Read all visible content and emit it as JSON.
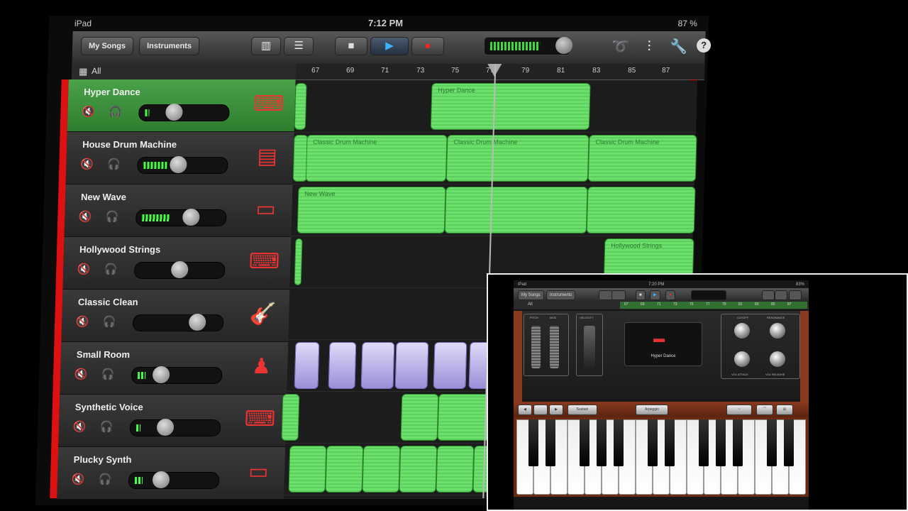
{
  "status": {
    "carrier": "iPad",
    "time": "7:12 PM",
    "battery": "87 %"
  },
  "toolbar": {
    "my_songs": "My Songs",
    "instruments": "Instruments"
  },
  "subbar": {
    "all": "All"
  },
  "ruler": {
    "bars": [
      "67",
      "69",
      "71",
      "73",
      "75",
      "77",
      "79",
      "81",
      "83",
      "85",
      "87"
    ]
  },
  "tracks": [
    {
      "name": "Hyper Dance",
      "level": 0.05,
      "volume": 0.36,
      "instrument_icon": "synth-keyboard-icon",
      "selected": true
    },
    {
      "name": "House Drum Machine",
      "level": 0.3,
      "volume": 0.44,
      "instrument_icon": "drum-machine-icon",
      "selected": false
    },
    {
      "name": "New Wave",
      "level": 0.35,
      "volume": 0.64,
      "instrument_icon": "synth-module-icon",
      "selected": false
    },
    {
      "name": "Hollywood Strings",
      "level": 0.0,
      "volume": 0.5,
      "instrument_icon": "synth-keyboard-icon",
      "selected": false
    },
    {
      "name": "Classic Clean",
      "level": 0.0,
      "volume": 0.76,
      "instrument_icon": "guitar-icon",
      "selected": false
    },
    {
      "name": "Small Room",
      "level": 0.1,
      "volume": 0.28,
      "instrument_icon": "drummer-icon",
      "selected": false
    },
    {
      "name": "Synthetic Voice",
      "level": 0.05,
      "volume": 0.36,
      "instrument_icon": "synth-keyboard-icon",
      "selected": false
    },
    {
      "name": "Plucky Synth",
      "level": 0.1,
      "volume": 0.32,
      "instrument_icon": "synth-module-icon",
      "selected": false
    }
  ],
  "regions": {
    "hyper_dance": "Hyper Dance",
    "drum": "Classic Drum Machine",
    "new_wave": "New Wave",
    "strings": "Hollywood Strings"
  },
  "inset": {
    "carrier": "iPad",
    "time": "7:20 PM",
    "battery": "83%",
    "my_songs": "My Songs",
    "instruments": "Instruments",
    "all": "All",
    "ruler_bars": [
      "67",
      "69",
      "71",
      "73",
      "75",
      "77",
      "79",
      "81",
      "83",
      "85",
      "87"
    ],
    "pitch_label": "PITCH",
    "mod_label": "MOD",
    "velocity_label": "VELOCITY",
    "cutoff_label": "CUTOFF",
    "resonance_label": "RESONANCE",
    "vol_attack_label": "VOL ATTACK",
    "vol_release_label": "VOL RELEASE",
    "instrument_name": "Hyper Dance",
    "sustain_label": "Sustain",
    "arpeggio_label": "Arpeggio"
  }
}
